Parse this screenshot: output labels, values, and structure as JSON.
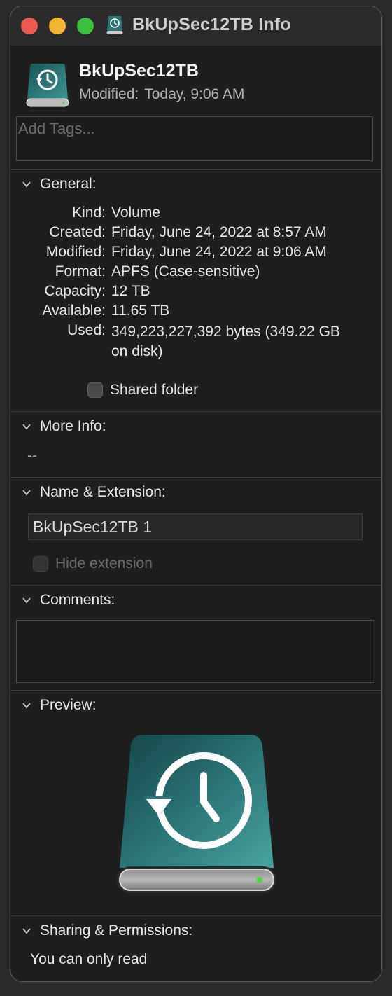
{
  "window": {
    "title": "BkUpSec12TB Info"
  },
  "header": {
    "name": "BkUpSec12TB",
    "modified_label": "Modified:",
    "modified_value": "Today, 9:06 AM"
  },
  "tags": {
    "placeholder": "Add Tags..."
  },
  "general": {
    "title": "General:",
    "rows": [
      {
        "label": "Kind:",
        "value": "Volume"
      },
      {
        "label": "Created:",
        "value": "Friday, June 24, 2022 at 8:57 AM"
      },
      {
        "label": "Modified:",
        "value": "Friday, June 24, 2022 at 9:06 AM"
      },
      {
        "label": "Format:",
        "value": "APFS (Case-sensitive)"
      },
      {
        "label": "Capacity:",
        "value": "12 TB"
      },
      {
        "label": "Available:",
        "value": "11.65 TB"
      },
      {
        "label": "Used:",
        "value": "349,223,227,392 bytes (349.22 GB on disk)"
      }
    ],
    "shared_folder_label": "Shared folder",
    "shared_folder_checked": false
  },
  "more_info": {
    "title": "More Info:",
    "text": "--"
  },
  "name_extension": {
    "title": "Name & Extension:",
    "name_value": "BkUpSec12TB 1",
    "hide_extension_label": "Hide extension",
    "hide_extension_checked": false
  },
  "comments": {
    "title": "Comments:",
    "value": ""
  },
  "preview": {
    "title": "Preview:"
  },
  "sharing": {
    "title": "Sharing & Permissions:",
    "text": "You can only read"
  },
  "colors": {
    "drive_teal": "#2f7f7f",
    "drive_teal_dark": "#17494c",
    "led_green": "#57d34a",
    "close": "#ee5a52",
    "minimize": "#f1b533",
    "maximize": "#37c13f"
  },
  "icons": {
    "title_icon": "time-machine-drive-icon",
    "volume_icon": "time-machine-drive-icon",
    "preview_icon": "time-machine-drive-icon"
  }
}
